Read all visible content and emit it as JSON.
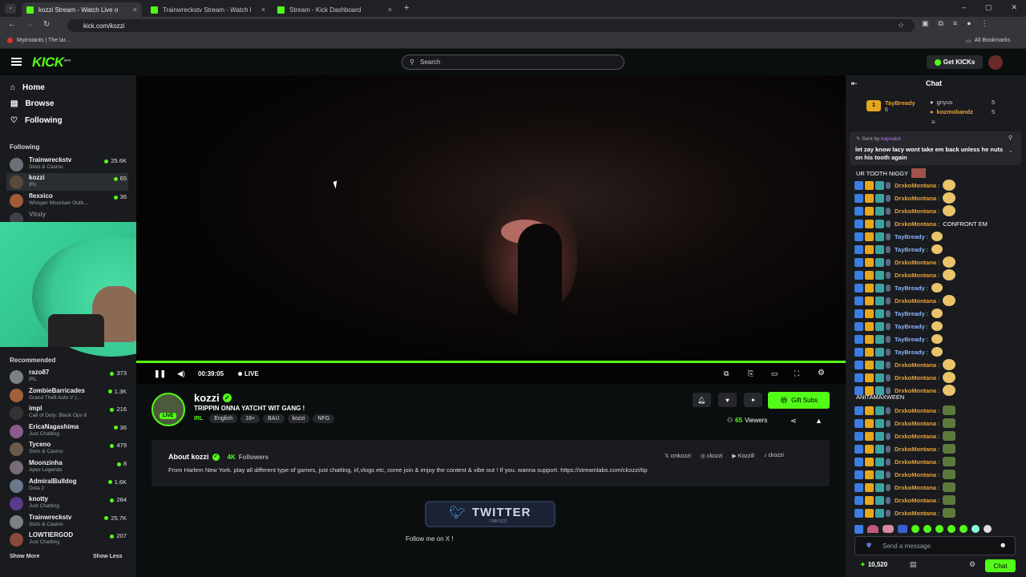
{
  "browser": {
    "tabs": [
      {
        "title": "kozzi Stream - Watch Live o"
      },
      {
        "title": "Trainwreckstv Stream - Watch l"
      },
      {
        "title": "Stream - Kick Dashboard"
      }
    ],
    "url": "kick.com/kozzi",
    "bookmark_left": "Myinstants | The lar...",
    "bookmark_right": "All Bookmarks"
  },
  "header": {
    "logo": "KICK",
    "logo_sup": "BETA",
    "search_placeholder": "Search",
    "get_kicks": "Get KICKs"
  },
  "sidebar": {
    "nav": [
      {
        "label": "Home",
        "icon": "home-icon"
      },
      {
        "label": "Browse",
        "icon": "browse-icon"
      },
      {
        "label": "Following",
        "icon": "heart-icon"
      }
    ],
    "following_title": "Following",
    "following": [
      {
        "name": "Trainwreckstv",
        "category": "Slots & Casino",
        "viewers": "25.6K"
      },
      {
        "name": "kozzi",
        "category": "IRL",
        "viewers": "65"
      },
      {
        "name": "flexxico",
        "category": "Whisper Mountain Outb...",
        "viewers": "36"
      },
      {
        "name": "Vitaly",
        "category": "",
        "viewers": ""
      }
    ],
    "recommended_title": "Recommended",
    "recommended": [
      {
        "name": "razo87",
        "category": "IRL",
        "viewers": "373"
      },
      {
        "name": "ZombieBarricades",
        "category": "Grand Theft Auto V (...",
        "viewers": "1.3K"
      },
      {
        "name": "impl",
        "category": "Call of Duty: Black Ops 6",
        "viewers": "216"
      },
      {
        "name": "EricaNagashima",
        "category": "Just Chatting",
        "viewers": "36"
      },
      {
        "name": "Tyceno",
        "category": "Slots & Casino",
        "viewers": "479"
      },
      {
        "name": "Moonzinha",
        "category": "Apex Legends",
        "viewers": "8"
      },
      {
        "name": "AdmiralBulldog",
        "category": "Dota 2",
        "viewers": "1.6K"
      },
      {
        "name": "knotty",
        "category": "Just Chatting",
        "viewers": "284"
      },
      {
        "name": "Trainwreckstv",
        "category": "Slots & Casino",
        "viewers": "25.7K"
      },
      {
        "name": "LOWTIERGOD",
        "category": "Just Chatting",
        "viewers": "207"
      }
    ],
    "show_more": "Show More",
    "show_less": "Show Less"
  },
  "player": {
    "time": "00:39:05",
    "live_label": "LIVE",
    "progress_fraction": 1.0
  },
  "stream": {
    "channel": "kozzi",
    "live_badge": "LIVE",
    "title": "TRIPPIN ONNA YATCHT WIT GANG !",
    "category": "IRL",
    "tags": [
      "English",
      "18+",
      "BAU",
      "kozzi",
      "NFG"
    ],
    "gift_subs": "Gift Subs",
    "viewers": "65",
    "viewers_label": "Viewers"
  },
  "about": {
    "title": "About kozzi",
    "followers": "4K",
    "followers_label": "Followers",
    "socials": [
      "cmkozzi",
      "ckozzi",
      "Kozzill",
      "ckozzi"
    ],
    "bio": "From Harlem New York. play all different type of games, just chatting, irl,vlogs etc, come join & enjoy the content & vibe out ! If you. wanna support. https://streamlabs.com/ckozzi/tip"
  },
  "panel": {
    "twitter_title": "TWITTER",
    "twitter_handle": "CMKOZZI",
    "follow_text": "Follow me on X !"
  },
  "chat": {
    "title": "Chat",
    "leaderboard": [
      {
        "rank": "1",
        "name": "TayBready",
        "count": "6"
      },
      {
        "name": "gnyus",
        "count": "5"
      },
      {
        "name": "kozmobandz",
        "count": "5"
      }
    ],
    "pinned_sent_by": "Sent by",
    "pinned_user": "kapnalot",
    "pinned_text": "let zay know lacy wont take em back unless he nuts on his tooth again",
    "partial_line": "UR TOOTH NIGGY",
    "messages": [
      {
        "user": "DrxkoMontana",
        "text": ""
      },
      {
        "user": "DrxkoMontana",
        "text": ""
      },
      {
        "user": "DrxkoMontana",
        "text": ""
      },
      {
        "user": "DrxkoMontana",
        "text": "CONFRONT EM"
      },
      {
        "user": "TayBready",
        "text": ""
      },
      {
        "user": "TayBready",
        "text": ""
      },
      {
        "user": "DrxkoMontana",
        "text": ""
      },
      {
        "user": "DrxkoMontana",
        "text": ""
      },
      {
        "user": "TayBready",
        "text": ""
      },
      {
        "user": "DrxkoMontana",
        "text": ""
      },
      {
        "user": "TayBready",
        "text": ""
      },
      {
        "user": "TayBready",
        "text": ""
      },
      {
        "user": "TayBready",
        "text": ""
      },
      {
        "user": "TayBready",
        "text": ""
      },
      {
        "user": "DrxkoMontana",
        "text": ""
      },
      {
        "user": "DrxkoMontana",
        "text": ""
      },
      {
        "user": "DrxkoMontana",
        "text": ""
      }
    ],
    "wrap_text": "ANITAMAXWEEN",
    "messages2": [
      {
        "user": "DrxkoMontana"
      },
      {
        "user": "DrxkoMontana"
      },
      {
        "user": "DrxkoMontana"
      },
      {
        "user": "DrxkoMontana"
      },
      {
        "user": "DrxkoMontana"
      },
      {
        "user": "DrxkoMontana"
      },
      {
        "user": "DrxkoMontana"
      },
      {
        "user": "DrxkoMontana"
      },
      {
        "user": "DrxkoMontana"
      }
    ],
    "input_placeholder": "Send a message",
    "points": "10,520",
    "send_label": "Chat"
  },
  "colors": {
    "accent": "#53fc18",
    "username_orange": "#e8a23a",
    "username_blue": "#8ab4f8",
    "username_purple": "#b47cf5"
  }
}
